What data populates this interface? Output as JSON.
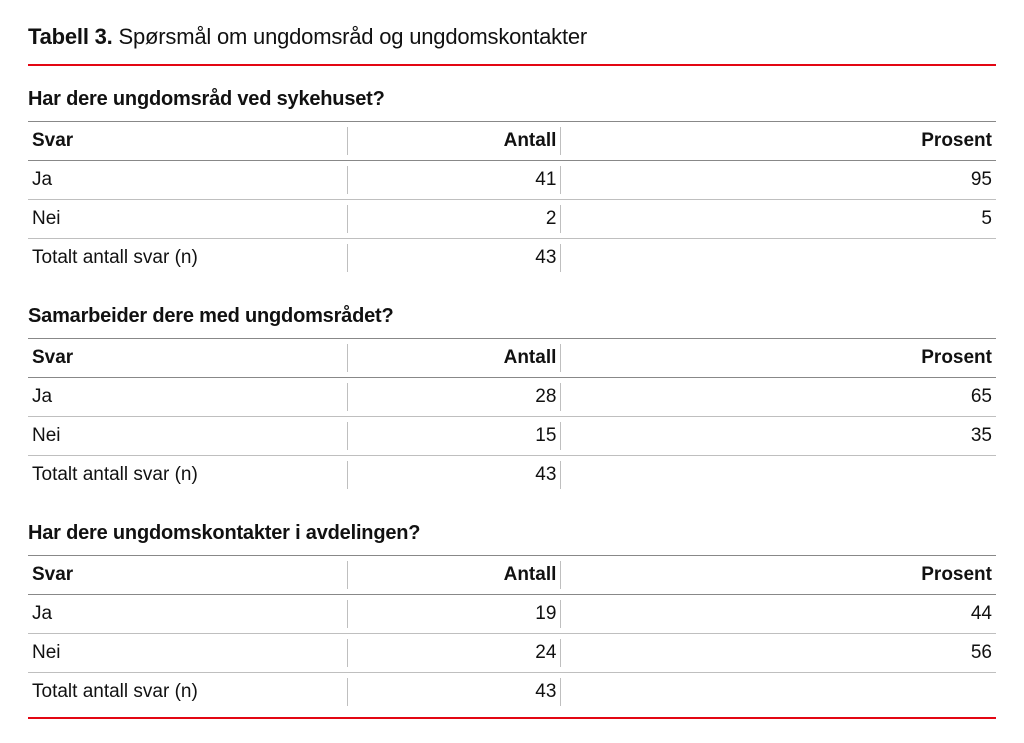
{
  "title": {
    "label": "Tabell 3.",
    "rest": "Spørsmål om ungdomsråd og ungdomskontakter"
  },
  "columns": {
    "answer": "Svar",
    "count": "Antall",
    "percent": "Prosent"
  },
  "labels": {
    "ja": "Ja",
    "nei": "Nei",
    "total": "Totalt antall svar (n)"
  },
  "sections": [
    {
      "question": "Har dere ungdomsråd ved sykehuset?",
      "ja": {
        "count": "41",
        "percent": "95"
      },
      "nei": {
        "count": "2",
        "percent": "5"
      },
      "total_count": "43"
    },
    {
      "question": "Samarbeider dere med ungdomsrådet?",
      "ja": {
        "count": "28",
        "percent": "65"
      },
      "nei": {
        "count": "15",
        "percent": "35"
      },
      "total_count": "43"
    },
    {
      "question": "Har dere ungdomskontakter i avdelingen?",
      "ja": {
        "count": "19",
        "percent": "44"
      },
      "nei": {
        "count": "24",
        "percent": "56"
      },
      "total_count": "43"
    }
  ],
  "chart_data": [
    {
      "type": "table",
      "title": "Har dere ungdomsråd ved sykehuset?",
      "categories": [
        "Ja",
        "Nei"
      ],
      "series": [
        {
          "name": "Antall",
          "values": [
            41,
            2
          ]
        },
        {
          "name": "Prosent",
          "values": [
            95,
            5
          ]
        }
      ],
      "n": 43
    },
    {
      "type": "table",
      "title": "Samarbeider dere med ungdomsrådet?",
      "categories": [
        "Ja",
        "Nei"
      ],
      "series": [
        {
          "name": "Antall",
          "values": [
            28,
            15
          ]
        },
        {
          "name": "Prosent",
          "values": [
            65,
            35
          ]
        }
      ],
      "n": 43
    },
    {
      "type": "table",
      "title": "Har dere ungdomskontakter i avdelingen?",
      "categories": [
        "Ja",
        "Nei"
      ],
      "series": [
        {
          "name": "Antall",
          "values": [
            19,
            24
          ]
        },
        {
          "name": "Prosent",
          "values": [
            44,
            56
          ]
        }
      ],
      "n": 43
    }
  ]
}
